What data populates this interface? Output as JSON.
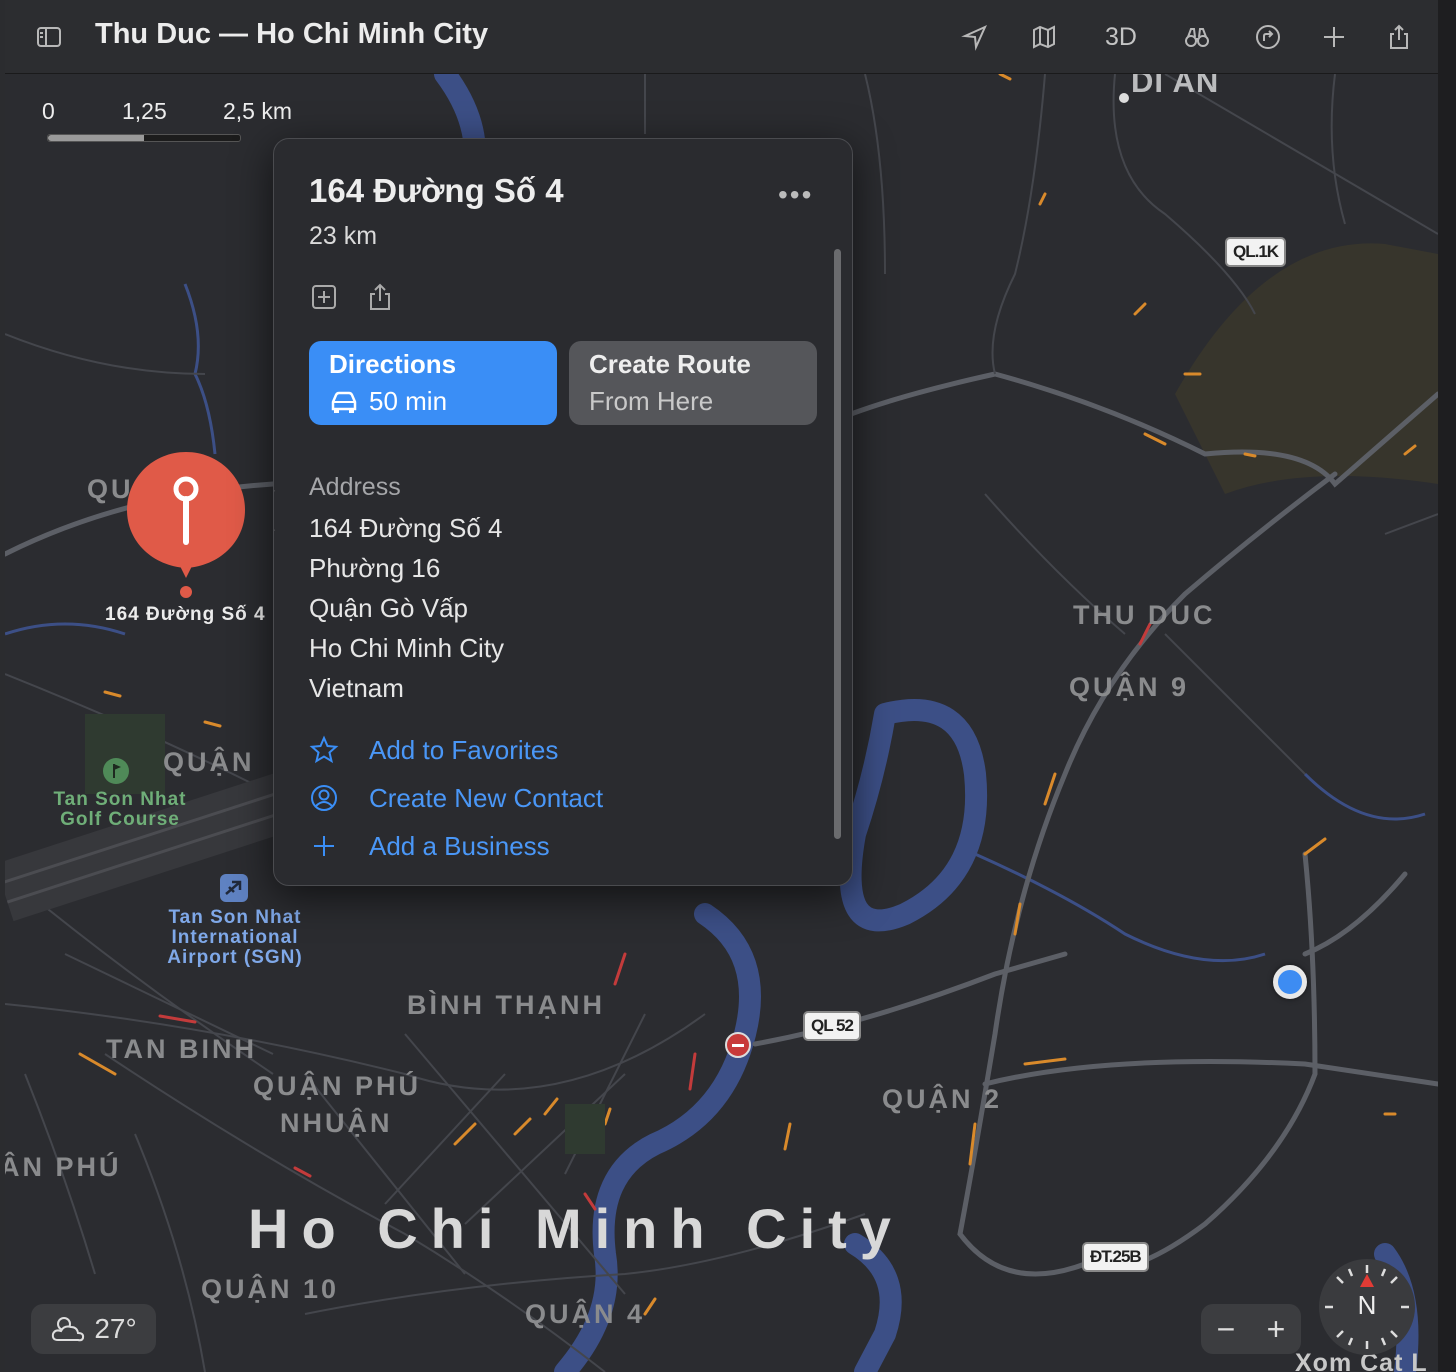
{
  "window": {
    "title": "Thu Duc — Ho Chi Minh City",
    "toolbar": {
      "sidebar_icon": "sidebar-icon",
      "location_icon": "location-arrow-icon",
      "map_mode_icon": "map-icon",
      "view_3d_label": "3D",
      "look_around_icon": "binoculars-icon",
      "directions_icon": "route-icon",
      "add_icon": "plus-icon",
      "share_icon": "share-icon"
    }
  },
  "scale": {
    "labels": [
      "0",
      "1,25",
      "2,5 km"
    ]
  },
  "map": {
    "labels": {
      "di_an": "DI AN",
      "thu_duc": "THU DUC",
      "quan_9": "QUẬN 9",
      "quan_2": "QUẬN 2",
      "binh_thanh": "BÌNH THẠNH",
      "tan_binh": "TAN BINH",
      "quan_phu_nhuan_1": "QUẬN PHÚ",
      "quan_phu_nhuan_2": "NHUẬN",
      "quan_partial": "QUẬN",
      "quan_left": "QU",
      "an_phu": "ÂN PHÚ",
      "quan_10": "QUẬN 10",
      "quan_4": "QUẬN 4",
      "ho_chi_minh_city": "Ho Chi Minh City",
      "xom_cat": "Xom Cat L"
    },
    "pois": {
      "golf_line1": "Tan Son Nhat",
      "golf_line2": "Golf Course",
      "airport_line1": "Tan Son Nhat",
      "airport_line2": "International",
      "airport_line3": "Airport (SGN)"
    },
    "road_shields": [
      "QL.1K",
      "QL 52",
      "ĐT.25B"
    ],
    "pin_label": "164 Đường Số 4",
    "weather": {
      "icon": "partly-cloudy-icon",
      "temp": "27°"
    },
    "zoom": {
      "out": "−",
      "in": "+"
    },
    "compass": {
      "label": "N"
    }
  },
  "card": {
    "title": "164 Đường Số 4",
    "distance": "23 km",
    "more": "•••",
    "directions": {
      "label": "Directions",
      "time": "50 min",
      "icon": "car-icon"
    },
    "route": {
      "line1": "Create Route",
      "line2": "From Here"
    },
    "address_heading": "Address",
    "address_lines": [
      "164 Đường Số 4",
      "Phường 16",
      "Quận Gò Vấp",
      "Ho Chi Minh City",
      "Vietnam"
    ],
    "actions": [
      {
        "label": "Add to Favorites",
        "icon": "star-icon"
      },
      {
        "label": "Create New Contact",
        "icon": "person-circle-icon"
      },
      {
        "label": "Add a Business",
        "icon": "plus-icon"
      }
    ],
    "colors": {
      "accent": "#3a8ef6",
      "pin": "#e05a48"
    }
  }
}
